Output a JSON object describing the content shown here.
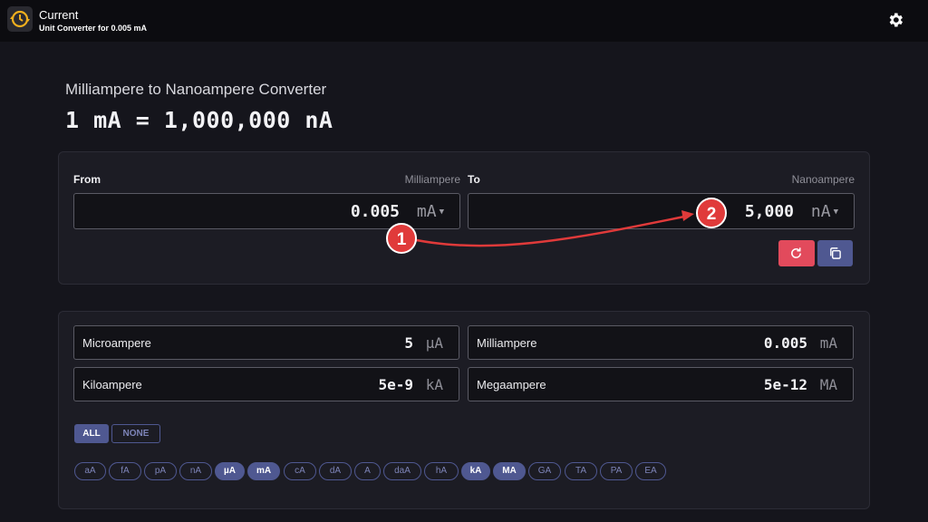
{
  "app": {
    "title": "Current",
    "subtitle": "Unit Converter for 0.005 mA"
  },
  "heading": "Milliampere to Nanoampere Converter",
  "result_line": "1 mA = 1,000,000 nA",
  "from": {
    "label": "From",
    "unit_name": "Milliampere",
    "value": "0.005",
    "unit": "mA"
  },
  "to": {
    "label": "To",
    "unit_name": "Nanoampere",
    "value": "5,000",
    "unit": "nA"
  },
  "results": [
    {
      "name": "Microampere",
      "value": "5",
      "unit": "µA"
    },
    {
      "name": "Milliampere",
      "value": "0.005",
      "unit": "mA"
    },
    {
      "name": "Kiloampere",
      "value": "5e-9",
      "unit": "kA"
    },
    {
      "name": "Megaampere",
      "value": "5e-12",
      "unit": "MA"
    }
  ],
  "filters": {
    "all": "ALL",
    "none": "NONE"
  },
  "chips": [
    {
      "label": "aA",
      "selected": false
    },
    {
      "label": "fA",
      "selected": false
    },
    {
      "label": "pA",
      "selected": false
    },
    {
      "label": "nA",
      "selected": false
    },
    {
      "label": "µA",
      "selected": true
    },
    {
      "label": "mA",
      "selected": true
    },
    {
      "label": "cA",
      "selected": false
    },
    {
      "label": "dA",
      "selected": false
    },
    {
      "label": "A",
      "selected": false
    },
    {
      "label": "daA",
      "selected": false
    },
    {
      "label": "hA",
      "selected": false
    },
    {
      "label": "kA",
      "selected": true
    },
    {
      "label": "MA",
      "selected": true
    },
    {
      "label": "GA",
      "selected": false
    },
    {
      "label": "TA",
      "selected": false
    },
    {
      "label": "PA",
      "selected": false
    },
    {
      "label": "EA",
      "selected": false
    }
  ],
  "annotations": [
    {
      "label": "1"
    },
    {
      "label": "2"
    }
  ],
  "colors": {
    "accent": "#4f5891",
    "reset": "#e24a5c",
    "annotation": "#e03a3a"
  },
  "icons": {
    "logo": "converter-clock-icon",
    "settings": "gear-icon",
    "reset": "refresh-icon",
    "copy": "copy-icon",
    "dropdown": "caret-down-icon"
  }
}
